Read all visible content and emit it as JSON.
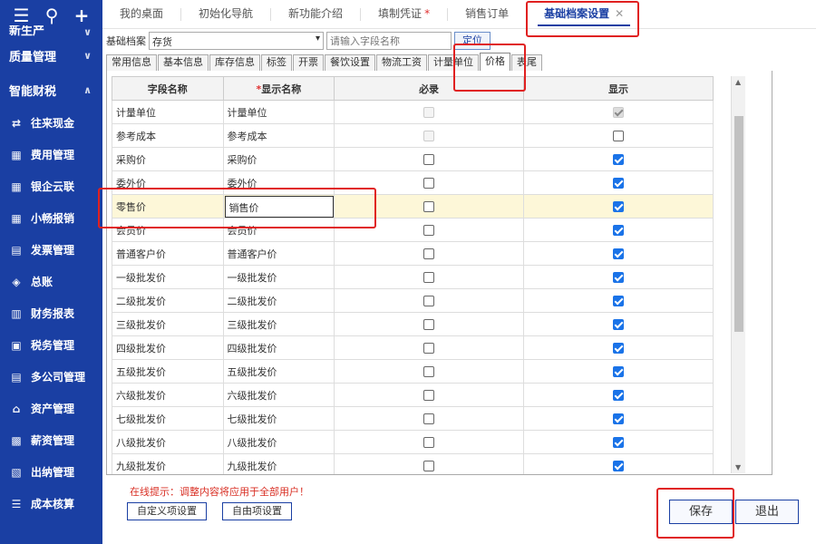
{
  "sidebar": {
    "partial_top_label": "新生产",
    "categories": [
      {
        "label": "质量管理",
        "chev": "∨"
      },
      {
        "label": "智能财税",
        "chev": "∧"
      }
    ],
    "items": [
      {
        "label": "往来现金",
        "icon": "transfer-icon",
        "glyph": "⇄"
      },
      {
        "label": "费用管理",
        "icon": "grid-icon",
        "glyph": "▦"
      },
      {
        "label": "银企云联",
        "icon": "grid-icon",
        "glyph": "▦"
      },
      {
        "label": "小畅报销",
        "icon": "grid-icon",
        "glyph": "▦"
      },
      {
        "label": "发票管理",
        "icon": "invoice-icon",
        "glyph": "▤"
      },
      {
        "label": "总账",
        "icon": "ledger-icon",
        "glyph": "◈"
      },
      {
        "label": "财务报表",
        "icon": "report-icon",
        "glyph": "▥"
      },
      {
        "label": "税务管理",
        "icon": "tax-icon",
        "glyph": "▣"
      },
      {
        "label": "多公司管理",
        "icon": "company-icon",
        "glyph": "▤"
      },
      {
        "label": "资产管理",
        "icon": "asset-icon",
        "glyph": "⌂"
      },
      {
        "label": "薪资管理",
        "icon": "salary-icon",
        "glyph": "▩"
      },
      {
        "label": "出纳管理",
        "icon": "cashier-icon",
        "glyph": "▧"
      },
      {
        "label": "成本核算",
        "icon": "cost-icon",
        "glyph": "☰"
      }
    ]
  },
  "tabs": [
    {
      "label": "我的桌面",
      "star": "",
      "active": false
    },
    {
      "label": "初始化导航",
      "star": "",
      "active": false
    },
    {
      "label": "新功能介绍",
      "star": "",
      "active": false
    },
    {
      "label": "填制凭证",
      "star": "*",
      "active": false
    },
    {
      "label": "销售订单",
      "star": "",
      "active": false
    },
    {
      "label": "基础档案设置",
      "star": "",
      "active": true,
      "close": "✕"
    }
  ],
  "toolbar": {
    "archive_label": "基础档案",
    "archive_value": "存货",
    "search_placeholder": "请输入字段名称",
    "locate_label": "定位"
  },
  "subtabs": [
    "常用信息",
    "基本信息",
    "库存信息",
    "标签",
    "开票",
    "餐饮设置",
    "物流工资",
    "计量单位",
    "价格",
    "表尾"
  ],
  "active_subtab": 8,
  "grid": {
    "headers": {
      "field": "字段名称",
      "display_req": "*",
      "display": "显示名称",
      "required": "必录",
      "show": "显示"
    },
    "rows": [
      {
        "field": "计量单位",
        "display": "计量单位",
        "required": "disabled-off",
        "show": "disabled-on"
      },
      {
        "field": "参考成本",
        "display": "参考成本",
        "required": "disabled-off",
        "show": "off"
      },
      {
        "field": "采购价",
        "display": "采购价",
        "required": "off",
        "show": "on"
      },
      {
        "field": "委外价",
        "display": "委外价",
        "required": "off",
        "show": "on"
      },
      {
        "field": "零售价",
        "display": "销售价",
        "required": "off",
        "show": "on",
        "editing": true
      },
      {
        "field": "会员价",
        "display": "会员价",
        "required": "off",
        "show": "on"
      },
      {
        "field": "普通客户价",
        "display": "普通客户价",
        "required": "off",
        "show": "on"
      },
      {
        "field": "一级批发价",
        "display": "一级批发价",
        "required": "off",
        "show": "on"
      },
      {
        "field": "二级批发价",
        "display": "二级批发价",
        "required": "off",
        "show": "on"
      },
      {
        "field": "三级批发价",
        "display": "三级批发价",
        "required": "off",
        "show": "on"
      },
      {
        "field": "四级批发价",
        "display": "四级批发价",
        "required": "off",
        "show": "on"
      },
      {
        "field": "五级批发价",
        "display": "五级批发价",
        "required": "off",
        "show": "on"
      },
      {
        "field": "六级批发价",
        "display": "六级批发价",
        "required": "off",
        "show": "on"
      },
      {
        "field": "七级批发价",
        "display": "七级批发价",
        "required": "off",
        "show": "on"
      },
      {
        "field": "八级批发价",
        "display": "八级批发价",
        "required": "off",
        "show": "on"
      },
      {
        "field": "九级批发价",
        "display": "九级批发价",
        "required": "off",
        "show": "on"
      }
    ]
  },
  "footer": {
    "tip": "在线提示：调整内容将应用于全部用户！",
    "custom_btn": "自定义项设置",
    "free_btn": "自由项设置",
    "save": "保存",
    "exit": "退出"
  },
  "colors": {
    "sidebar": "#1a3fa3",
    "accent": "#1a73e8",
    "annotation": "#e02020",
    "tip": "#d93025"
  }
}
